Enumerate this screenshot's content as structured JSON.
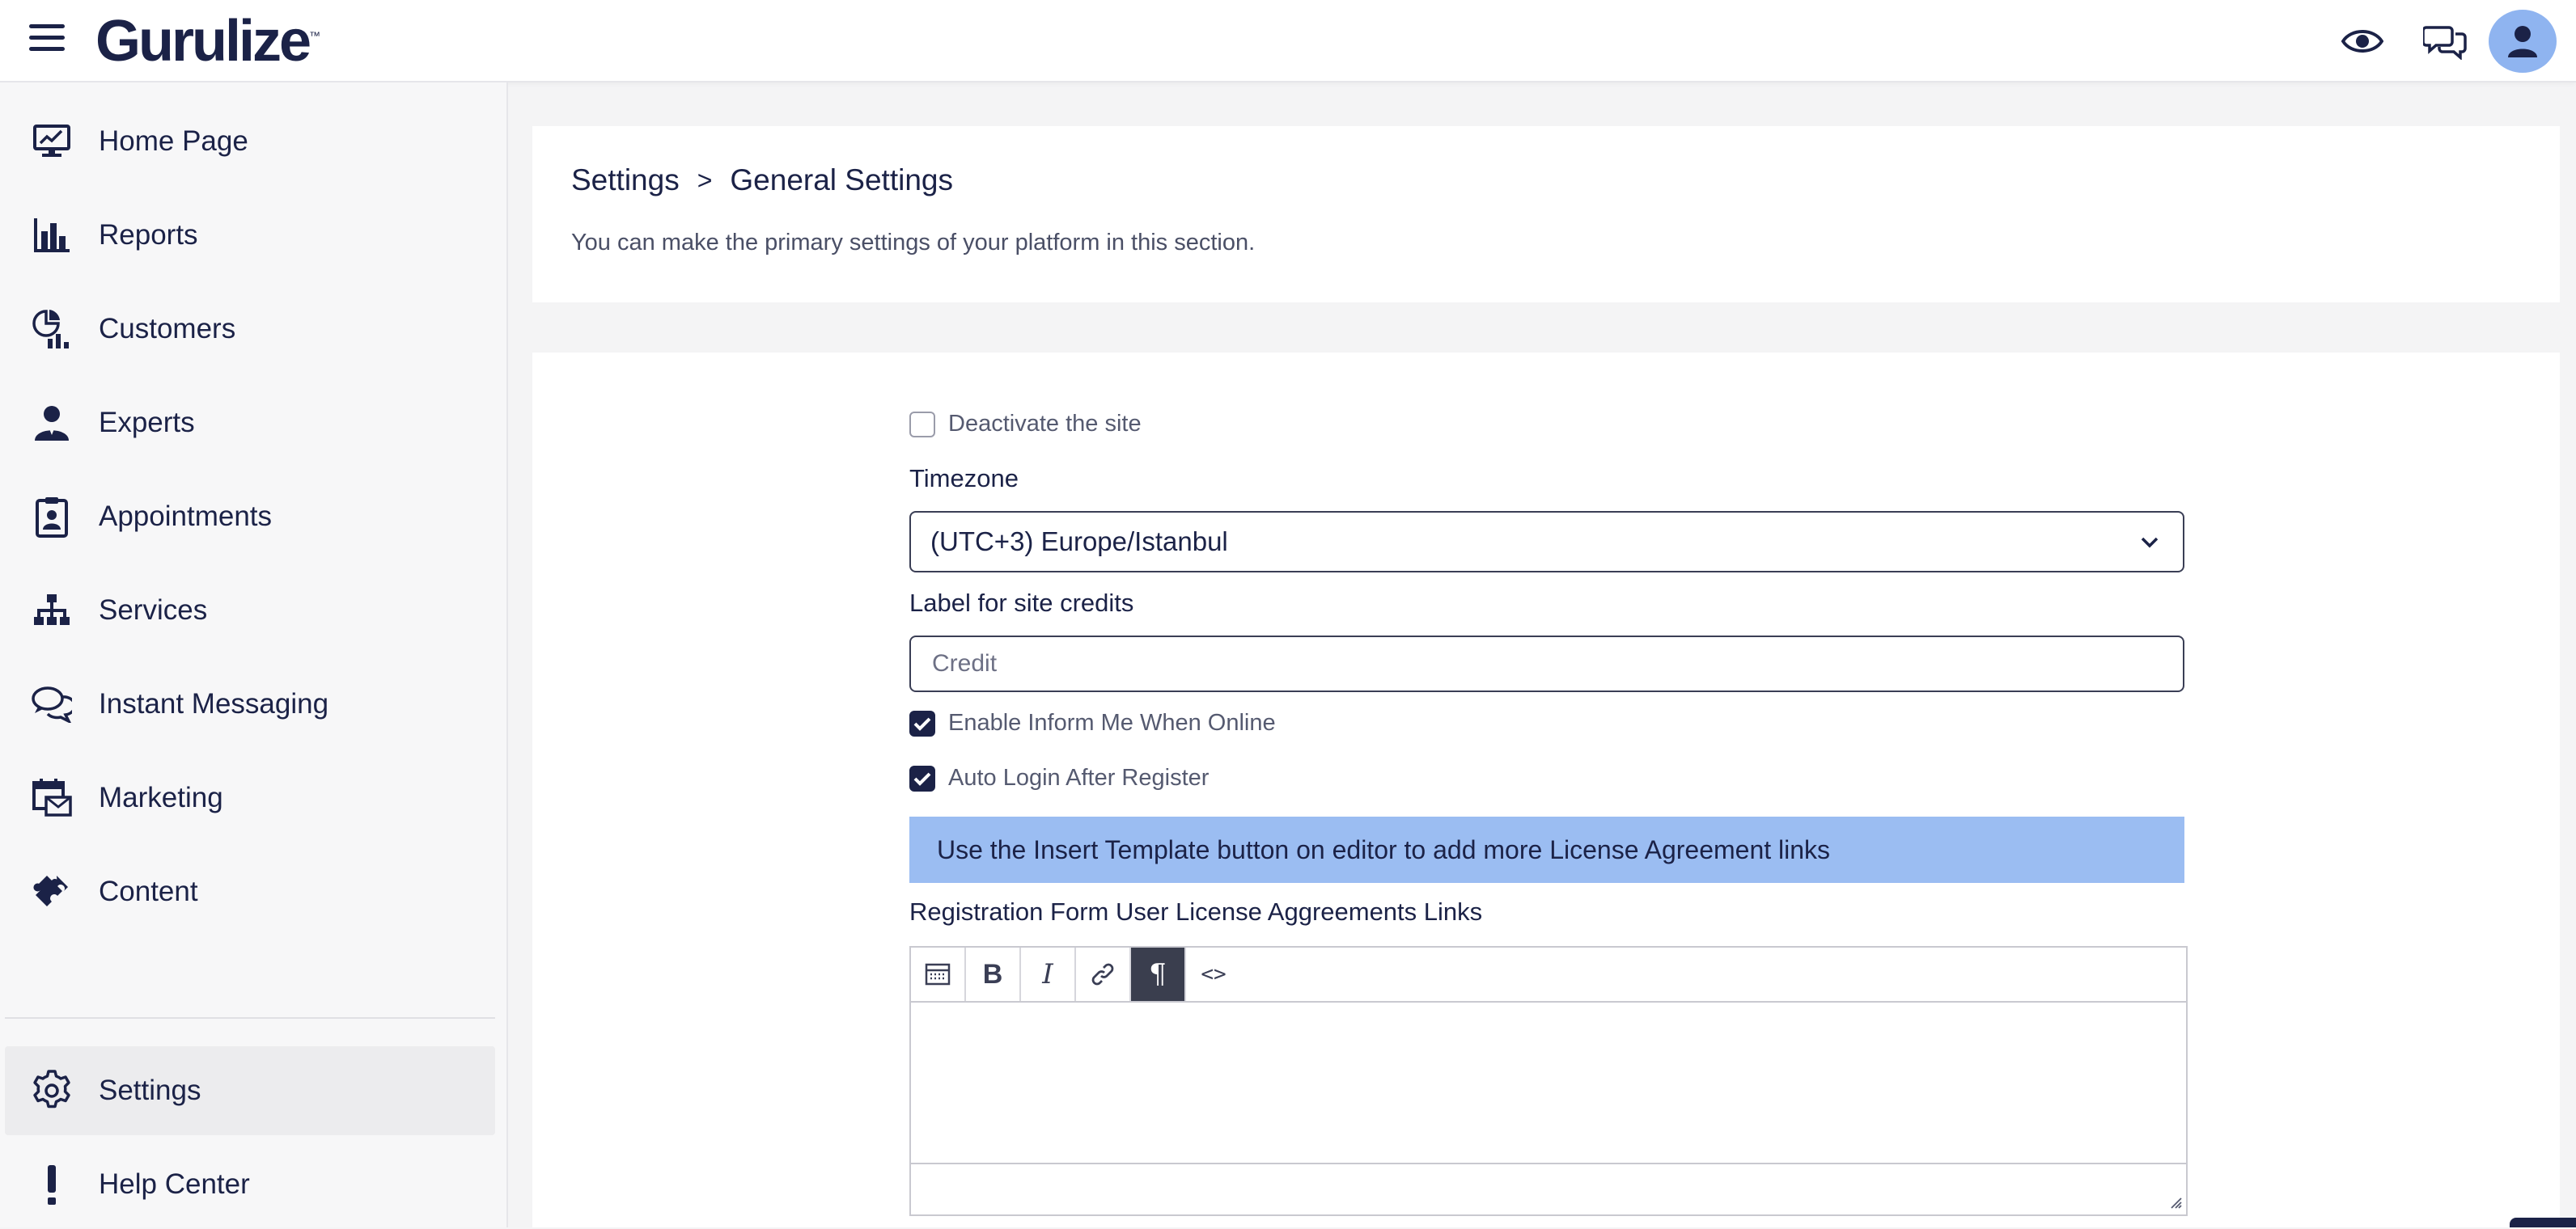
{
  "app": {
    "logo_text": "Gurulize",
    "logo_mark": "™"
  },
  "topbar": {
    "icons": [
      "menu-icon",
      "eye-icon",
      "chat-icon",
      "user-icon"
    ]
  },
  "sidebar": {
    "items": [
      {
        "label": "Home Page",
        "icon": "monitor-chart-icon"
      },
      {
        "label": "Reports",
        "icon": "bar-chart-icon"
      },
      {
        "label": "Customers",
        "icon": "pie-chart-icon"
      },
      {
        "label": "Experts",
        "icon": "expert-user-icon"
      },
      {
        "label": "Appointments",
        "icon": "clipboard-user-icon"
      },
      {
        "label": "Services",
        "icon": "sitemap-icon"
      },
      {
        "label": "Instant Messaging",
        "icon": "chat-bubbles-icon"
      },
      {
        "label": "Marketing",
        "icon": "calendar-mail-icon"
      },
      {
        "label": "Content",
        "icon": "puzzle-icon"
      }
    ],
    "bottom_items": [
      {
        "label": "Settings",
        "icon": "gear-icon",
        "active": true
      },
      {
        "label": "Help Center",
        "icon": "exclamation-icon"
      }
    ]
  },
  "header": {
    "breadcrumb": [
      "Settings",
      "General Settings"
    ],
    "separator": ">",
    "description": "You can make the primary settings of your platform in this section."
  },
  "form": {
    "deactivate_label": "Deactivate the site",
    "deactivate_checked": false,
    "timezone_label": "Timezone",
    "timezone_value": "(UTC+3) Europe/Istanbul",
    "credits_label": "Label for site credits",
    "credits_placeholder": "Credit",
    "inform_online_label": "Enable Inform Me When Online",
    "inform_online_checked": true,
    "auto_login_label": "Auto Login After Register",
    "auto_login_checked": true,
    "info_banner": "Use the Insert Template button on editor to add more License Agreement links",
    "agreements_label": "Registration Form User License Aggreements Links",
    "editor_toolbar": [
      {
        "name": "insert-template-icon",
        "glyph": ""
      },
      {
        "name": "bold-icon",
        "glyph": "B"
      },
      {
        "name": "italic-icon",
        "glyph": "I"
      },
      {
        "name": "link-icon",
        "glyph": ""
      },
      {
        "name": "paragraph-icon",
        "glyph": "¶",
        "active": true
      },
      {
        "name": "source-code-icon",
        "glyph": "<>"
      }
    ]
  },
  "colors": {
    "primary": "#1b2247",
    "avatar_bg": "#8fb4f0",
    "banner_bg": "#9bbdf2",
    "page_bg": "#f4f4f5"
  }
}
